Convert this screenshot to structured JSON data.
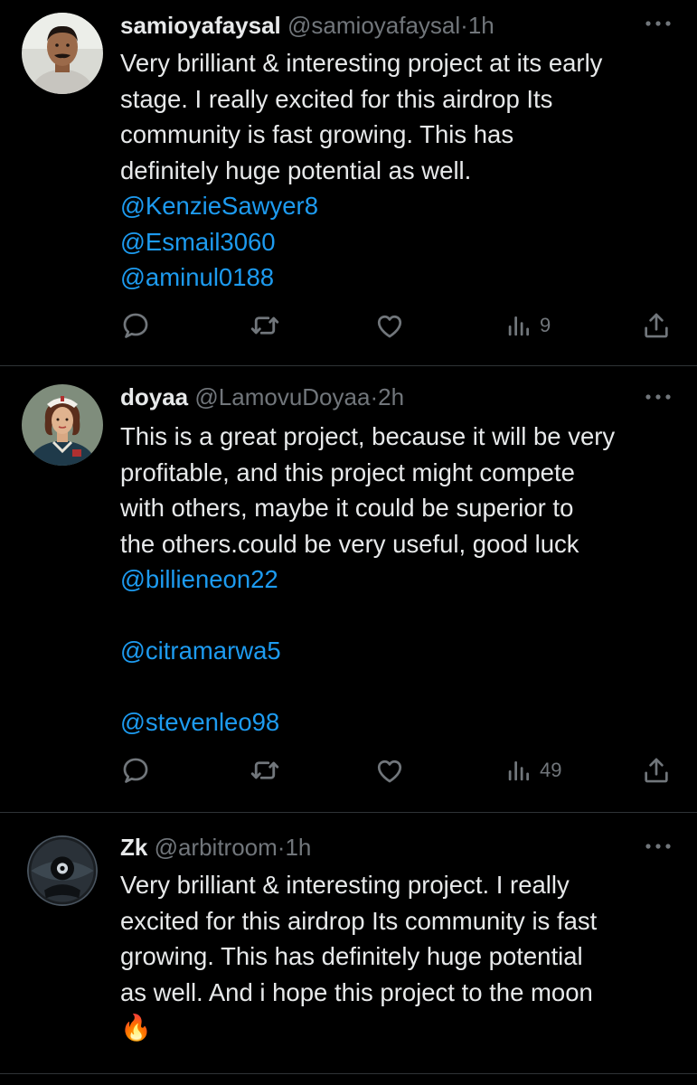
{
  "tweets": [
    {
      "name": "samioyafaysal",
      "handle": "@samioyafaysal",
      "separator": "·",
      "time": "1h",
      "text_lines": [
        "Very brilliant & interesting project at its early",
        "stage. I really excited for this  airdrop Its",
        "community is fast growing. This has",
        "definitely huge potential as well."
      ],
      "mentions": [
        "@KenzieSawyer8",
        "@Esmail3060",
        "@aminul0188"
      ],
      "views": "9",
      "icons": {
        "reply": "reply-icon",
        "retweet": "retweet-icon",
        "like": "like-icon",
        "views": "views-icon",
        "share": "share-icon",
        "more": "more-icon"
      }
    },
    {
      "name": "doyaa",
      "handle": "@LamovuDoyaa",
      "separator": "·",
      "time": "2h",
      "text_lines": [
        "This is a great project, because it will be very",
        "profitable, and this project might compete",
        "with others, maybe it could be superior to",
        "the others.could be very useful, good luck"
      ],
      "mentions": [
        "@billieneon22",
        "@citramarwa5",
        "@stevenleo98"
      ],
      "views": "49"
    },
    {
      "name": "Zk",
      "handle": "@arbitroom",
      "separator": "·",
      "time": "1h",
      "text_lines": [
        "Very brilliant & interesting project. I really",
        "excited for this  airdrop Its community is fast",
        "growing. This has definitely huge potential",
        "as well. And i hope this project to the moon"
      ],
      "emoji": "🔥"
    }
  ],
  "colors": {
    "background": "#000000",
    "text": "#e7e9ea",
    "muted": "#71767b",
    "link": "#1d9bf0",
    "divider": "#2f3336"
  }
}
